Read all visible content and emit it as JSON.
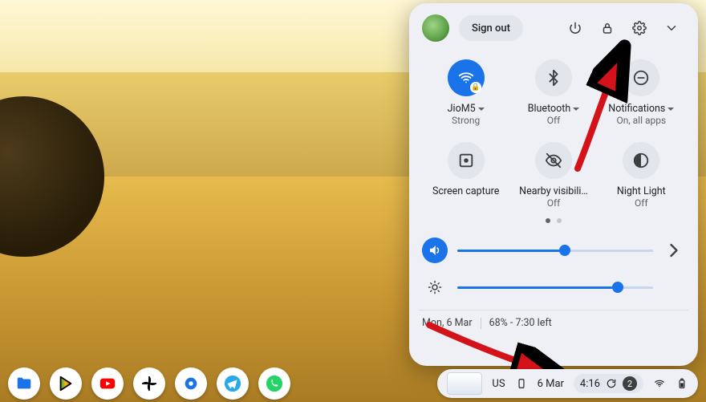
{
  "panel": {
    "signout_label": "Sign out",
    "tiles": [
      {
        "label": "JioM5",
        "sub": "Strong",
        "active": true,
        "caret": true
      },
      {
        "label": "Bluetooth",
        "sub": "Off",
        "active": false,
        "caret": true
      },
      {
        "label": "Notifications",
        "sub": "On, all apps",
        "active": false,
        "caret": true
      },
      {
        "label": "Screen capture",
        "sub": "",
        "active": false,
        "caret": false
      },
      {
        "label": "Nearby visibili…",
        "sub": "Off",
        "active": false,
        "caret": false
      },
      {
        "label": "Night Light",
        "sub": "Off",
        "active": false,
        "caret": false
      }
    ],
    "pager": {
      "count": 2,
      "active": 0
    },
    "volume_pct": 55,
    "brightness_pct": 82,
    "footer_date": "Mon, 6 Mar",
    "footer_battery": "68% - 7:30 left"
  },
  "shelf": {
    "apps": [
      "files",
      "play-store",
      "youtube",
      "photos",
      "settings",
      "telegram",
      "whatsapp"
    ],
    "keyboard": "US",
    "date": "6 Mar",
    "time": "4:16",
    "notification_count": "2"
  }
}
